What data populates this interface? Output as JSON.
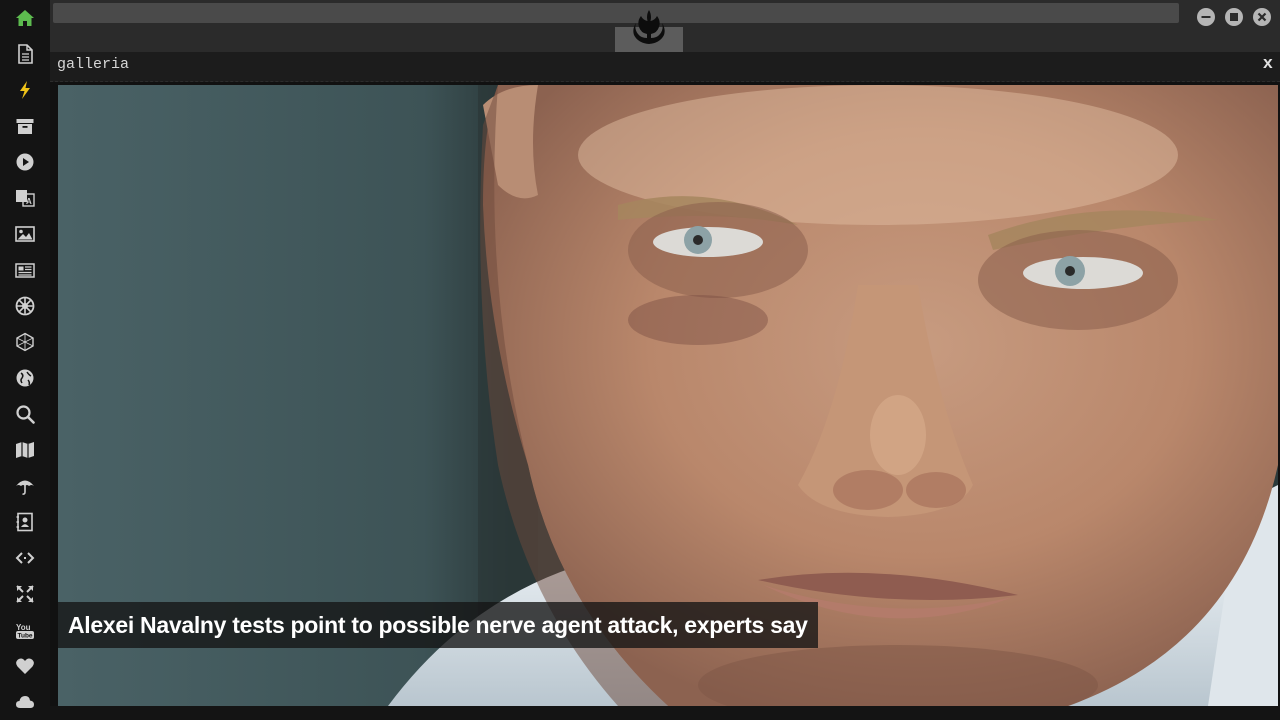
{
  "rail": {
    "items": [
      {
        "name": "home-icon",
        "color": "#5dbb4f"
      },
      {
        "name": "document-icon",
        "color": "#d0d0d0"
      },
      {
        "name": "lightning-icon",
        "color": "#f0c419"
      },
      {
        "name": "archive-icon",
        "color": "#d0d0d0"
      },
      {
        "name": "play-icon",
        "color": "#d0d0d0"
      },
      {
        "name": "translate-icon",
        "color": "#d0d0d0"
      },
      {
        "name": "image-icon",
        "color": "#d0d0d0"
      },
      {
        "name": "newspaper-icon",
        "color": "#d0d0d0"
      },
      {
        "name": "galactic-empire-icon",
        "color": "#d0d0d0"
      },
      {
        "name": "hexagon-icon",
        "color": "#d0d0d0"
      },
      {
        "name": "globe-icon",
        "color": "#d0d0d0"
      },
      {
        "name": "search-icon",
        "color": "#d0d0d0"
      },
      {
        "name": "map-icon",
        "color": "#d0d0d0"
      },
      {
        "name": "umbrella-icon",
        "color": "#d0d0d0"
      },
      {
        "name": "contacts-icon",
        "color": "#d0d0d0"
      },
      {
        "name": "code-icon",
        "color": "#d0d0d0"
      },
      {
        "name": "expand-icon",
        "color": "#d0d0d0"
      },
      {
        "name": "youtube-icon",
        "color": "#d0d0d0"
      },
      {
        "name": "heart-icon",
        "color": "#d0d0d0"
      },
      {
        "name": "cloud-icon",
        "color": "#d0d0d0"
      }
    ]
  },
  "topbar": {
    "brand_icon": "rebel-alliance-icon",
    "window_controls": [
      "minimize-icon",
      "maximize-icon",
      "close-icon"
    ]
  },
  "gallery": {
    "title": "galleria",
    "close_label": "x",
    "caption": "Alexei Navalny tests point to possible nerve agent attack, experts say"
  }
}
